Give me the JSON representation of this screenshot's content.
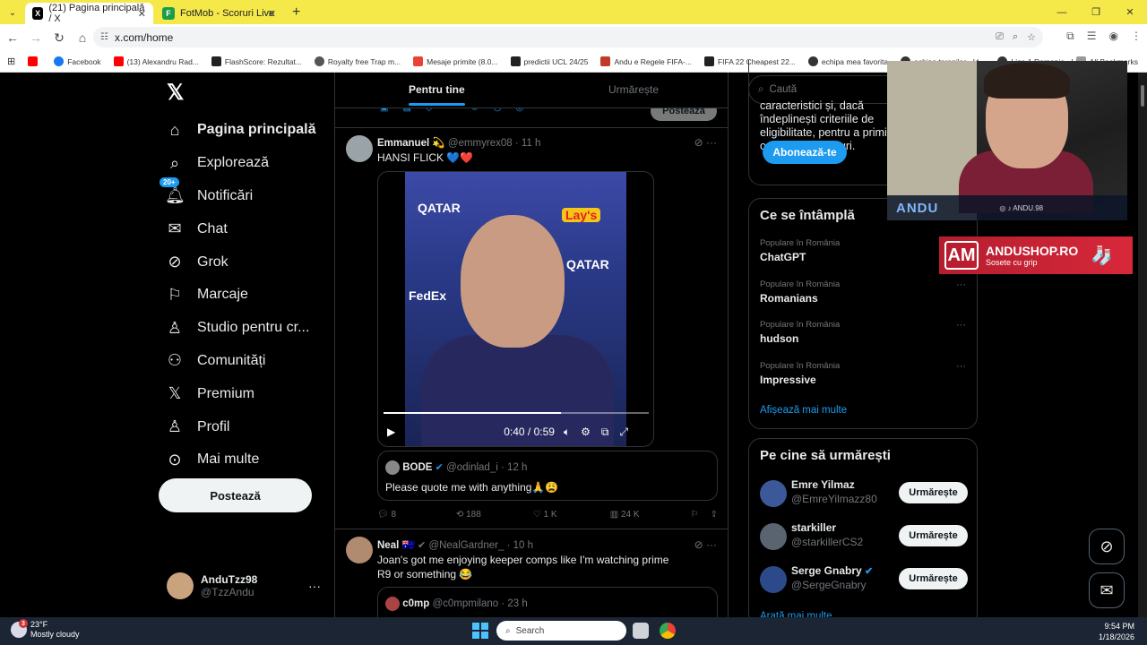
{
  "browser": {
    "tabs": [
      {
        "title": "(21) Pagina principală / X",
        "favicon": "X",
        "active": true
      },
      {
        "title": "FotMob - Scoruri Live",
        "favicon": "F",
        "active": false
      }
    ],
    "url": "x.com/home",
    "bookmarks": [
      "Facebook",
      "(13) Alexandru Rad...",
      "FlashScore: Rezultat...",
      "Royalty free Trap m...",
      "Mesaje primite (8.0...",
      "predictii UCL 24/25",
      "Andu e Regele FIFA-...",
      "FIFA 22 Cheapest 22...",
      "echipa mea favorita",
      "echipa taranilor - Li...",
      "Liga 1 Romania - Lis..."
    ],
    "all_bookmarks": "All Bookmarks"
  },
  "nav": {
    "items": [
      {
        "label": "Pagina principală",
        "icon": "home-icon"
      },
      {
        "label": "Explorează",
        "icon": "search-icon"
      },
      {
        "label": "Notificări",
        "icon": "bell-icon",
        "badge": "20+"
      },
      {
        "label": "Chat",
        "icon": "mail-icon"
      },
      {
        "label": "Grok",
        "icon": "grok-icon"
      },
      {
        "label": "Marcaje",
        "icon": "bookmark-icon"
      },
      {
        "label": "Studio pentru cr...",
        "icon": "studio-icon"
      },
      {
        "label": "Comunități",
        "icon": "communities-icon"
      },
      {
        "label": "Premium",
        "icon": "x-logo-icon"
      },
      {
        "label": "Profil",
        "icon": "person-icon"
      },
      {
        "label": "Mai multe",
        "icon": "more-circle-icon"
      }
    ],
    "post_label": "Postează",
    "account": {
      "name": "AnduTzz98",
      "handle": "@TzzAndu"
    }
  },
  "feed": {
    "tabs": [
      "Pentru tine",
      "Urmărește"
    ],
    "compose_post": "Postează",
    "tweet1": {
      "name": "Emmanuel",
      "handle": "@emmyrex08",
      "time": "11 h",
      "text": "HANSI FLICK 💙❤️",
      "video_time": "0:40 / 0:59",
      "video_progress": 0.67,
      "quote": {
        "name": "BODE",
        "handle": "@odinlad_i",
        "time": "12 h",
        "text": "Please quote me with anything🙏😩"
      },
      "replies": "8",
      "reposts": "188",
      "likes": "1 K",
      "views": "24 K"
    },
    "tweet2": {
      "name": "Neal",
      "handle": "@NealGardner_",
      "time": "10 h",
      "text": "Joan's got me enjoying keeper comps like I'm watching prime R9 or something 😂",
      "quote": {
        "name": "c0mp",
        "handle": "@c0mpmilano",
        "time": "23 h"
      }
    }
  },
  "sidebar": {
    "search_placeholder": "Caută",
    "premium_text": "caracteristici și, dacă îndeplinești criteriile de eligibilitate, pentru a primi o parte din venituri.",
    "subscribe_label": "Abonează-te",
    "trends_title": "Ce se întâmplă",
    "trends": [
      {
        "context": "Populare în România",
        "topic": "ChatGPT"
      },
      {
        "context": "Populare în România",
        "topic": "Romanians"
      },
      {
        "context": "Populare în România",
        "topic": "hudson"
      },
      {
        "context": "Populare în România",
        "topic": "Impressive"
      }
    ],
    "show_more": "Afișează mai multe",
    "who_title": "Pe cine să urmărești",
    "who": [
      {
        "name": "Emre Yilmaz",
        "handle": "@EmreYilmazz80",
        "verified": false
      },
      {
        "name": "starkiller",
        "handle": "@starkillerCS2",
        "verified": false
      },
      {
        "name": "Serge Gnabry",
        "handle": "@SergeGnabry",
        "verified": true
      }
    ],
    "follow_label": "Urmărește",
    "show_more_2": "Arată mai multe"
  },
  "overlay": {
    "streamer_name": "ANDU",
    "social": "ANDU.98",
    "ad_title": "ANDUSHOP.RO",
    "ad_sub": "Sosete cu grip",
    "ad_logo": "AM"
  },
  "taskbar": {
    "temp": "23°F",
    "condition": "Mostly cloudy",
    "weather_badge": "3",
    "search": "Search",
    "time": "9:54 PM",
    "date": "1/18/2026"
  }
}
